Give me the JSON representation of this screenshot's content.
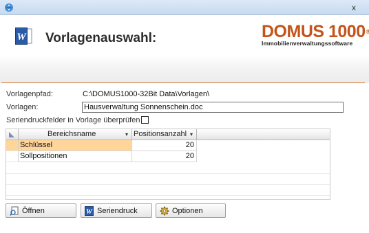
{
  "titlebar": {
    "close_label": "x"
  },
  "header": {
    "title": "Vorlagenauswahl:",
    "brand_name": "DOMUS 1000",
    "brand_reg": "®",
    "brand_tagline": "Immobilienverwaltungssoftware"
  },
  "form": {
    "path_label": "Vorlagenpfad:",
    "path_value": "C:\\DOMUS1000-32Bit Data\\Vorlagen\\",
    "template_label": "Vorlagen:",
    "template_value": "Hausverwaltung Sonnenschein.doc",
    "check_label": "Seriendruckfelder in Vorlage überprüfen",
    "check_checked": false
  },
  "grid": {
    "columns": [
      "Bereichsname",
      "Positionsanzahl"
    ],
    "rows": [
      {
        "name": "Schlüssel",
        "count": "20",
        "selected": true
      },
      {
        "name": "Sollpositionen",
        "count": "20",
        "selected": false
      }
    ]
  },
  "buttons": {
    "open": "Öffnen",
    "merge": "Seriendruck",
    "options": "Optionen"
  },
  "colors": {
    "brand": "#c4541b",
    "separator": "#d0752f",
    "selection": "#ffd59a"
  }
}
